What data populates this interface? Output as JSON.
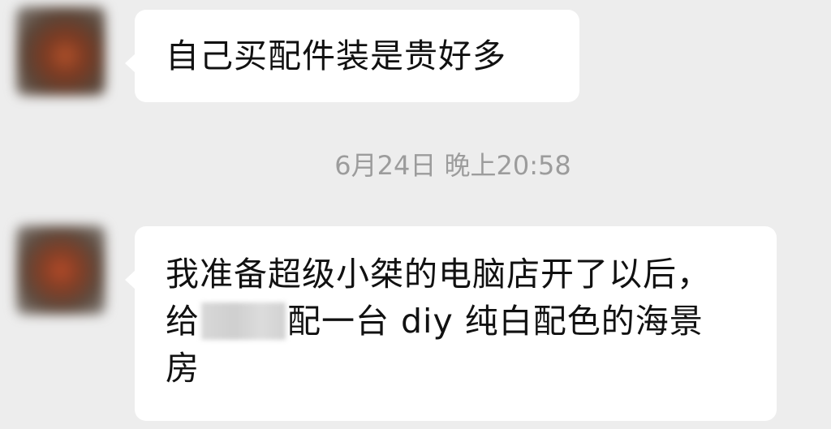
{
  "timestamp": "6月24日 晚上20:58",
  "messages": [
    {
      "text": "自己买配件装是贵好多"
    },
    {
      "line1": "我准备超级小桀的电脑店开了以后，",
      "line2_before": "给",
      "line2_after": "配一台 diy 纯白配色的海景",
      "line3": "房"
    }
  ],
  "icons": {
    "avatar": "avatar-blurred"
  }
}
